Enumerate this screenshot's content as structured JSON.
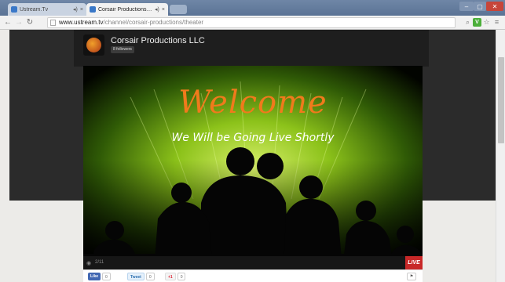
{
  "browser": {
    "tabs": [
      {
        "label": "Ustream.Tv"
      },
      {
        "label": "Corsair Productions LLC"
      }
    ],
    "url_host": "www.ustream.tv",
    "url_path": "/channel/corsair-productions/theater"
  },
  "channel": {
    "name": "Corsair Productions LLC",
    "followers": "8 followers"
  },
  "player": {
    "welcome": "Welcome",
    "subtitle": "We Will be Going Live Shortly",
    "viewers": "2/11",
    "live_label": "LIVE"
  },
  "social": {
    "like_label": "Like",
    "like_count": "0",
    "tweet_label": "Tweet",
    "tweet_count": "0",
    "gplus_label": "+1",
    "gplus_count": "0"
  },
  "colors": {
    "accent": "#f07a1c",
    "live": "#c82828"
  }
}
